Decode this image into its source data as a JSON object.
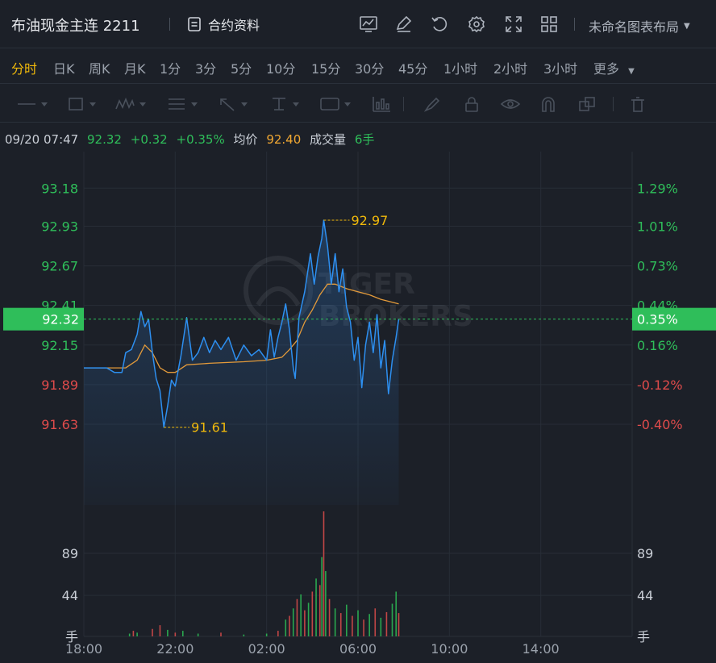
{
  "header": {
    "title": "布油现金主连 2211",
    "contract_info": "合约资料",
    "layout_name": "未命名图表布局",
    "icons": [
      "chart-settings-icon",
      "edit-icon",
      "refresh-icon",
      "gear-icon",
      "fullscreen-icon",
      "grid-layout-icon"
    ]
  },
  "periods": {
    "items": [
      "分时",
      "日K",
      "周K",
      "月K",
      "1分",
      "3分",
      "5分",
      "10分",
      "15分",
      "30分",
      "45分",
      "1小时",
      "2小时",
      "3小时",
      "更多"
    ],
    "active": "分时"
  },
  "drawing_tools": [
    "line-tool-icon",
    "rect-tool-icon",
    "wave-tool-icon",
    "text-tool-icon",
    "arrow-tool-icon",
    "measure-tool-icon",
    "label-tool-icon",
    "indicator-tool-icon",
    "brush-icon",
    "lock-icon",
    "eye-icon",
    "magnet-icon",
    "clone-icon",
    "trash-icon"
  ],
  "quote": {
    "datetime": "09/20 07:47",
    "price": "92.32",
    "change": "+0.32",
    "change_pct": "+0.35%",
    "avg_label": "均价",
    "avg_value": "92.40",
    "volume_label": "成交量",
    "volume_value": "6手"
  },
  "watermark": {
    "line1": "TIGER",
    "line2": "BROKERS"
  },
  "colors": {
    "up": "#2fbe5a",
    "down": "#e04b4b",
    "price_line": "#2d8ff0",
    "avg_line": "#e39a3a",
    "accent": "#f0b90b"
  },
  "chart_data": {
    "type": "line",
    "x_ticks": [
      "18:00",
      "22:00",
      "02:00",
      "06:00",
      "10:00",
      "14:00"
    ],
    "y_left_ticks": [
      {
        "value": 93.18,
        "label": "93.18",
        "side": "up"
      },
      {
        "value": 92.93,
        "label": "92.93",
        "side": "up"
      },
      {
        "value": 92.67,
        "label": "92.67",
        "side": "up"
      },
      {
        "value": 92.41,
        "label": "92.41",
        "side": "up"
      },
      {
        "value": 92.15,
        "label": "92.15",
        "side": "up"
      },
      {
        "value": 91.89,
        "label": "91.89",
        "side": "down"
      },
      {
        "value": 91.63,
        "label": "91.63",
        "side": "down"
      }
    ],
    "y_right_ticks": [
      {
        "value": 93.18,
        "label": "1.29%",
        "side": "up"
      },
      {
        "value": 92.93,
        "label": "1.01%",
        "side": "up"
      },
      {
        "value": 92.67,
        "label": "0.73%",
        "side": "up"
      },
      {
        "value": 92.41,
        "label": "0.44%",
        "side": "up"
      },
      {
        "value": 92.15,
        "label": "0.16%",
        "side": "up"
      },
      {
        "value": 91.89,
        "label": "-0.12%",
        "side": "down"
      },
      {
        "value": 91.63,
        "label": "-0.40%",
        "side": "down"
      }
    ],
    "current_price": {
      "value": 92.32,
      "label": "92.32",
      "pct_label": "0.35%"
    },
    "high": {
      "value": 92.97,
      "label": "92.97",
      "time": "04:30"
    },
    "low": {
      "value": 91.61,
      "label": "91.61",
      "time": "21:30"
    },
    "price_series": {
      "name": "price",
      "points": [
        [
          "18:00",
          92.0
        ],
        [
          "19:00",
          92.0
        ],
        [
          "19:20",
          91.97
        ],
        [
          "19:40",
          91.97
        ],
        [
          "19:50",
          92.1
        ],
        [
          "20:05",
          92.12
        ],
        [
          "20:20",
          92.22
        ],
        [
          "20:30",
          92.37
        ],
        [
          "20:40",
          92.27
        ],
        [
          "20:50",
          92.32
        ],
        [
          "21:00",
          92.1
        ],
        [
          "21:10",
          91.93
        ],
        [
          "21:20",
          91.85
        ],
        [
          "21:30",
          91.61
        ],
        [
          "21:40",
          91.75
        ],
        [
          "21:50",
          91.92
        ],
        [
          "22:00",
          91.88
        ],
        [
          "22:15",
          92.08
        ],
        [
          "22:30",
          92.33
        ],
        [
          "22:45",
          92.05
        ],
        [
          "23:00",
          92.1
        ],
        [
          "23:15",
          92.2
        ],
        [
          "23:30",
          92.1
        ],
        [
          "23:45",
          92.18
        ],
        [
          "00:00",
          92.12
        ],
        [
          "00:20",
          92.2
        ],
        [
          "00:40",
          92.05
        ],
        [
          "01:00",
          92.15
        ],
        [
          "01:20",
          92.08
        ],
        [
          "01:40",
          92.12
        ],
        [
          "02:00",
          92.05
        ],
        [
          "02:10",
          92.25
        ],
        [
          "02:20",
          92.07
        ],
        [
          "02:30",
          92.2
        ],
        [
          "02:40",
          92.3
        ],
        [
          "02:50",
          92.42
        ],
        [
          "03:00",
          92.25
        ],
        [
          "03:10",
          92.0
        ],
        [
          "03:15",
          91.93
        ],
        [
          "03:25",
          92.33
        ],
        [
          "03:40",
          92.5
        ],
        [
          "03:55",
          92.75
        ],
        [
          "04:05",
          92.55
        ],
        [
          "04:15",
          92.73
        ],
        [
          "04:25",
          92.85
        ],
        [
          "04:30",
          92.97
        ],
        [
          "04:40",
          92.8
        ],
        [
          "04:50",
          92.55
        ],
        [
          "05:00",
          92.75
        ],
        [
          "05:10",
          92.5
        ],
        [
          "05:20",
          92.65
        ],
        [
          "05:30",
          92.4
        ],
        [
          "05:40",
          92.3
        ],
        [
          "05:50",
          92.05
        ],
        [
          "06:00",
          92.2
        ],
        [
          "06:10",
          91.87
        ],
        [
          "06:20",
          92.15
        ],
        [
          "06:30",
          92.3
        ],
        [
          "06:40",
          92.1
        ],
        [
          "06:50",
          92.35
        ],
        [
          "07:00",
          92.0
        ],
        [
          "07:10",
          92.18
        ],
        [
          "07:20",
          91.83
        ],
        [
          "07:30",
          92.05
        ],
        [
          "07:40",
          92.2
        ],
        [
          "07:47",
          92.32
        ]
      ]
    },
    "avg_series": {
      "name": "avg",
      "points": [
        [
          "18:00",
          92.0
        ],
        [
          "19:50",
          92.0
        ],
        [
          "20:20",
          92.05
        ],
        [
          "20:40",
          92.15
        ],
        [
          "21:00",
          92.1
        ],
        [
          "21:20",
          92.0
        ],
        [
          "21:40",
          91.97
        ],
        [
          "22:00",
          91.97
        ],
        [
          "22:30",
          92.02
        ],
        [
          "23:30",
          92.03
        ],
        [
          "01:00",
          92.04
        ],
        [
          "02:00",
          92.05
        ],
        [
          "02:40",
          92.07
        ],
        [
          "03:00",
          92.12
        ],
        [
          "03:20",
          92.18
        ],
        [
          "03:40",
          92.3
        ],
        [
          "04:00",
          92.38
        ],
        [
          "04:20",
          92.48
        ],
        [
          "04:40",
          92.55
        ],
        [
          "05:00",
          92.55
        ],
        [
          "05:30",
          92.52
        ],
        [
          "06:00",
          92.5
        ],
        [
          "06:30",
          92.48
        ],
        [
          "07:00",
          92.45
        ],
        [
          "07:47",
          92.42
        ]
      ]
    },
    "volume": {
      "y_ticks": [
        "89",
        "44"
      ],
      "unit": "手",
      "max": 134,
      "bars": [
        [
          "20:00",
          3,
          "up"
        ],
        [
          "20:10",
          6,
          "down"
        ],
        [
          "20:20",
          4,
          "up"
        ],
        [
          "21:00",
          8,
          "down"
        ],
        [
          "21:20",
          12,
          "down"
        ],
        [
          "21:40",
          7,
          "up"
        ],
        [
          "22:00",
          4,
          "down"
        ],
        [
          "22:20",
          6,
          "up"
        ],
        [
          "23:00",
          3,
          "up"
        ],
        [
          "00:00",
          4,
          "down"
        ],
        [
          "01:00",
          2,
          "up"
        ],
        [
          "02:00",
          3,
          "up"
        ],
        [
          "02:30",
          6,
          "down"
        ],
        [
          "02:50",
          18,
          "up"
        ],
        [
          "03:00",
          22,
          "down"
        ],
        [
          "03:10",
          30,
          "up"
        ],
        [
          "03:20",
          40,
          "down"
        ],
        [
          "03:30",
          45,
          "up"
        ],
        [
          "03:40",
          28,
          "down"
        ],
        [
          "03:50",
          36,
          "up"
        ],
        [
          "04:00",
          48,
          "down"
        ],
        [
          "04:10",
          62,
          "up"
        ],
        [
          "04:20",
          55,
          "down"
        ],
        [
          "04:25",
          85,
          "up"
        ],
        [
          "04:30",
          134,
          "down"
        ],
        [
          "04:35",
          70,
          "up"
        ],
        [
          "04:45",
          40,
          "down"
        ],
        [
          "05:00",
          30,
          "up"
        ],
        [
          "05:15",
          25,
          "down"
        ],
        [
          "05:30",
          34,
          "up"
        ],
        [
          "05:45",
          22,
          "down"
        ],
        [
          "06:00",
          28,
          "up"
        ],
        [
          "06:15",
          18,
          "down"
        ],
        [
          "06:30",
          24,
          "up"
        ],
        [
          "06:45",
          30,
          "down"
        ],
        [
          "07:00",
          20,
          "up"
        ],
        [
          "07:15",
          26,
          "down"
        ],
        [
          "07:30",
          35,
          "up"
        ],
        [
          "07:40",
          48,
          "up"
        ],
        [
          "07:47",
          25,
          "down"
        ]
      ]
    }
  }
}
